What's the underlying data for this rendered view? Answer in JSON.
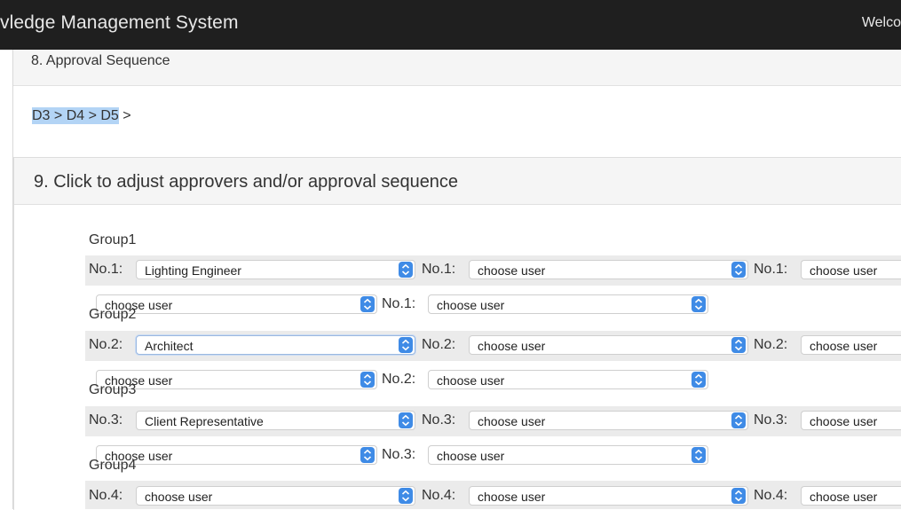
{
  "header": {
    "title": "vledge Management System",
    "welcome": "Welco"
  },
  "section8": {
    "title": "8. Approval Sequence",
    "sequence_highlight": "D3 > D4 > D5",
    "sequence_rest": " >"
  },
  "section9": {
    "title": "9. Click to adjust approvers and/or approval sequence"
  },
  "groups": [
    {
      "label": "Group1",
      "no": "No.1:",
      "row1": [
        "Lighting Engineer",
        "choose user",
        "choose user"
      ],
      "row2": [
        "choose user",
        "choose user"
      ]
    },
    {
      "label": "Group2",
      "no": "No.2:",
      "row1": [
        "Architect",
        "choose user",
        "choose user"
      ],
      "row2": [
        "choose user",
        "choose user"
      ]
    },
    {
      "label": "Group3",
      "no": "No.3:",
      "row1": [
        "Client Representative",
        "choose user",
        "choose user"
      ],
      "row2": [
        "choose user",
        "choose user"
      ]
    },
    {
      "label": "Group4",
      "no": "No.4:",
      "row1": [
        "choose user",
        "choose user",
        "choose user"
      ]
    }
  ],
  "colors": {
    "topbar": "#1f1f1f",
    "highlight": "#b3d4f5",
    "caret": "#3f8be6"
  },
  "icons": {
    "select_arrows": "updown-chevron-icon"
  }
}
